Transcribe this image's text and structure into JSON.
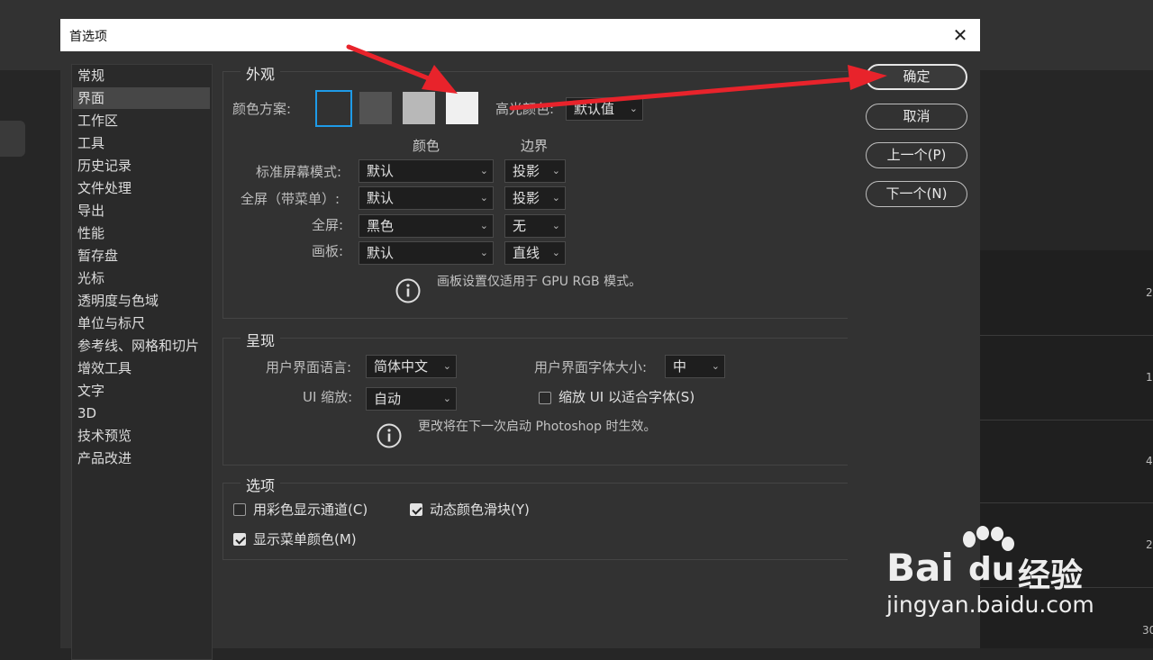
{
  "dialog_title": "首选项",
  "sidebar": {
    "items": [
      {
        "label": "常规"
      },
      {
        "label": "界面"
      },
      {
        "label": "工作区"
      },
      {
        "label": "工具"
      },
      {
        "label": "历史记录"
      },
      {
        "label": "文件处理"
      },
      {
        "label": "导出"
      },
      {
        "label": "性能"
      },
      {
        "label": "暂存盘"
      },
      {
        "label": "光标"
      },
      {
        "label": "透明度与色域"
      },
      {
        "label": "单位与标尺"
      },
      {
        "label": "参考线、网格和切片"
      },
      {
        "label": "增效工具"
      },
      {
        "label": "文字"
      },
      {
        "label": "3D"
      },
      {
        "label": "技术预览"
      },
      {
        "label": "产品改进"
      }
    ],
    "active_index": 1
  },
  "appearance": {
    "title": "外观",
    "color_scheme_label": "颜色方案:",
    "swatch_colors": [
      "#323232",
      "#535353",
      "#b8b8b8",
      "#f0f0f0"
    ],
    "highlight_label": "高光颜色:",
    "highlight_value": "默认值",
    "col_color": "颜色",
    "col_border": "边界",
    "rows": [
      {
        "label": "标准屏幕模式:",
        "color": "默认",
        "border": "投影"
      },
      {
        "label": "全屏（带菜单）:",
        "color": "默认",
        "border": "投影"
      },
      {
        "label": "全屏:",
        "color": "黑色",
        "border": "无"
      },
      {
        "label": "画板:",
        "color": "默认",
        "border": "直线"
      }
    ],
    "note": "画板设置仅适用于 GPU RGB 模式。"
  },
  "presentation": {
    "title": "呈现",
    "ui_lang_label": "用户界面语言:",
    "ui_lang_value": "简体中文",
    "font_size_label": "用户界面字体大小:",
    "font_size_value": "中",
    "ui_scale_label": "UI 缩放:",
    "ui_scale_value": "自动",
    "scale_check_label": "缩放 UI 以适合字体(S)",
    "note": "更改将在下一次启动 Photoshop 时生效。"
  },
  "options": {
    "title": "选项",
    "items": [
      {
        "label": "用彩色显示通道(C)",
        "checked": false
      },
      {
        "label": "动态颜色滑块(Y)",
        "checked": true
      },
      {
        "label": "显示菜单颜色(M)",
        "checked": true
      }
    ]
  },
  "buttons": {
    "ok": "确定",
    "cancel": "取消",
    "prev": "上一个(P)",
    "next": "下一个(N)"
  },
  "background": {
    "numbers": [
      "2",
      "1",
      "4",
      "2",
      "30"
    ]
  },
  "watermark": {
    "brand": "Bai",
    "brand2": "du",
    "cn": "经验",
    "url": "jingyan.baidu.com"
  },
  "accent_color": "#e8232b",
  "selection_border_color": "#1e9be8"
}
